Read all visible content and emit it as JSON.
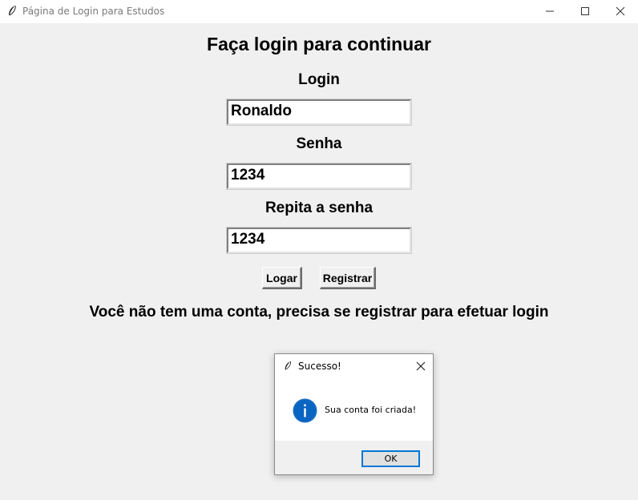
{
  "window": {
    "title": "Página de Login para Estudos"
  },
  "form": {
    "heading": "Faça login para continuar",
    "login_label": "Login",
    "login_value": "Ronaldo",
    "password_label": "Senha",
    "password_value": "1234",
    "repeat_label": "Repita a senha",
    "repeat_value": "1234",
    "login_button": "Logar",
    "register_button": "Registrar",
    "message": "Você não tem uma conta, precisa se registrar para efetuar login"
  },
  "dialog": {
    "title": "Sucesso!",
    "message": "Sua conta foi criada!",
    "ok_label": "OK",
    "icon": "info-icon"
  },
  "colors": {
    "background": "#f0f0f0",
    "accent": "#0078d7"
  }
}
